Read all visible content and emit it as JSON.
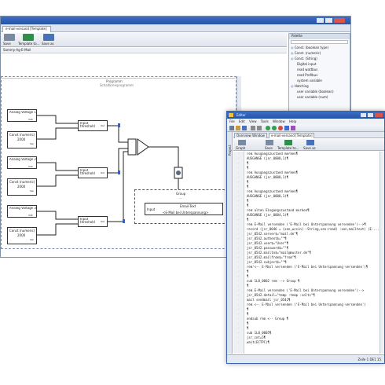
{
  "main_window": {
    "title": "e-mail-versand [Template]",
    "toolbar": {
      "btn1": "Save",
      "btn2": "Template to...",
      "btn3": "Save as"
    },
    "breadcrumb": "Sammy-Ag-E-Mail",
    "diagram_title": "Programm",
    "diagram_subtitle": "Schaltkreisprogramm",
    "blocks": {
      "analog1": {
        "title": "Analog Voltage 1",
        "port": "Volt"
      },
      "analog2": {
        "title": "Analog Voltage 2",
        "port": "Volt"
      },
      "analog3": {
        "title": "Analog Voltage 3",
        "port": "Volt"
      },
      "const1": {
        "title": "Const (numeric)",
        "value": "2000",
        "port": "Val"
      },
      "const2": {
        "title": "Const (numeric)",
        "value": "2000",
        "port": "Val"
      },
      "const3": {
        "title": "Const (numeric)",
        "value": "2000",
        "port": "Val"
      },
      "thresh1": {
        "title": "Input threshold",
        "port": "Out"
      },
      "thresh2": {
        "title": "Input threshold",
        "port": "Out"
      },
      "thresh3": {
        "title": "Input threshold",
        "port": "Out"
      },
      "group_title": "Group",
      "group_sub": "...",
      "inner_title": "Email-Text",
      "inner_left": "Input",
      "inner_text": "<E-Mail bei Unterspannung>"
    },
    "palette": {
      "title": "Palette",
      "items": [
        "Const. (boolean type)",
        "Const. (numeric)",
        "Const. (String)",
        "Digital input",
        "read wattbus",
        "read Profibus",
        "system variable",
        "Hatching",
        "user variable (boolean)",
        "user variable (num)"
      ]
    }
  },
  "editor_window": {
    "title": "Editor",
    "menu": [
      "File",
      "Edit",
      "View",
      "Tools",
      "Window",
      "Help"
    ],
    "tabs": [
      "Overview Window",
      "e-mail-versand [Template]"
    ],
    "toolbar": {
      "b1": "Graph",
      "b2": "Save",
      "b3": "Template to...",
      "b4": "Save as"
    },
    "side_tab": "Project",
    "status": "Zeile 1   DE1 15",
    "code_lines": [
      "rem Ausgangszustand merken¶",
      "AUSGANGE (jsr_0000,1)¶",
      "¶",
      "¶",
      "rem Ausgangszustand merken¶",
      "AUSGANGE (jsr_0000,1)¶",
      "¶",
      "¶",
      "rem Ausgangszustand merken¶",
      "AUSGANGE (jsr_0000,1)¶",
      "¶",
      "¶",
      "rem alten Eingangszustand merken¶",
      "AUSGANGE (jsr_0004,1)¶",
      "¶",
      "rem E-Mail versenden ('E-Mail bei Unterspannung versenden')-->¶",
      "record (jsr_0046 = (xen,wcsin) :String,xen:read) :xen,mailtext) (E-...",
      "jsr_0542.server$=\"mail.de\"¶",
      "jsr_0542.authent$=\"\"¶",
      "jsr_0542.user$=\"User\"¶",
      "jsr_0542.password$=\"\"¶",
      "jsr_0542.mailto$=\"mail@muster.de\"¶",
      "jsr_0542.mailfrom$=\"from\"¶",
      "jsr_0542.subject$=\"\"¶",
      "rem'<-- E-Mail versenden ('E-Mail bei Unterspannung versenden')¶",
      "¶",
      "¶",
      "sub 1L0_0002 rem --> Group ¶",
      "¶",
      "  rem E-Mail versenden ('E-Mail bei Unterspannung versenden')-->",
      "        jsr_0542.detail=\"temp  :temp  :volts\"¶",
      "    mail sendmail jsr_0542¶",
      "  rem <-- E-Mail versenden ('E-Mail bei Unterspannung versenden')",
      "¶",
      "¶",
      "endsub rem <-- Group ¶",
      "¶",
      "¶",
      "sub 1L0_0005¶",
      "jsr_cnt=5¶",
      "  wait(ECTPC)¶"
    ]
  }
}
